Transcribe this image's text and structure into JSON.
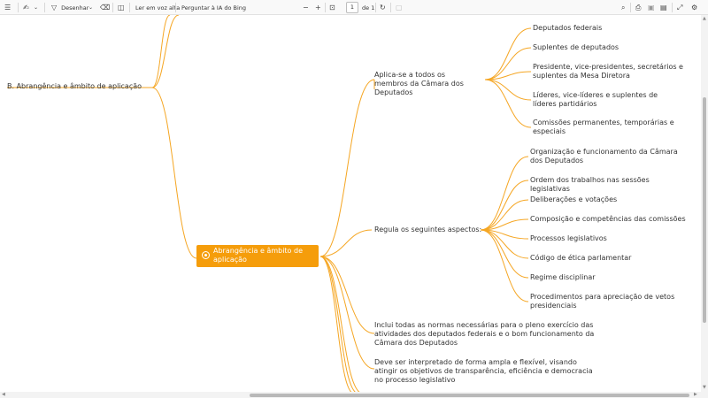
{
  "toolbar": {
    "draw_label": "Desenhar",
    "read_aloud_label": "Ler em voz alta",
    "ask_bing_label": "Perguntar à IA do Bing",
    "page_current": "1",
    "page_total": "de 1",
    "zoom_out_symbol": "−",
    "zoom_in_symbol": "+",
    "icons": [
      "contents-icon",
      "highlight-icon",
      "draw-icon",
      "eraser-icon",
      "page-view-icon",
      "zoom-out-icon",
      "zoom-in-icon",
      "fit-page-icon",
      "rotate-icon",
      "print-icon",
      "save-icon",
      "save-as-icon",
      "fullscreen-icon",
      "settings-icon"
    ]
  },
  "mindmap": {
    "branch_color": "#f5a623",
    "center_color": "#f59d0b",
    "center_label": "Abrangência e âmbito de aplicação",
    "left_label": "B. Abrangência e âmbito de aplicação",
    "group1": {
      "label": "Aplica-se a todos os membros da Câmara dos Deputados",
      "items": [
        "Deputados federais",
        "Suplentes de deputados",
        "Presidente, vice-presidentes, secretários e suplentes da Mesa Diretora",
        "Líderes, vice-líderes e suplentes de líderes partidários",
        "Comissões permanentes, temporárias e especiais"
      ]
    },
    "group2": {
      "label": "Regula os seguintes aspectos:",
      "items": [
        "Organização e funcionamento da Câmara dos Deputados",
        "Ordem dos trabalhos nas sessões legislativas",
        "Deliberações e votações",
        "Composição e competências das comissões",
        "Processos legislativos",
        "Código de ética parlamentar",
        "Regime disciplinar",
        "Procedimentos para apreciação de vetos presidenciais"
      ]
    },
    "group3_label": "Inclui todas as normas necessárias para o pleno exercício das atividades dos deputados federais e o bom funcionamento da Câmara dos Deputados",
    "group4_label": "Deve ser interpretado de forma ampla e flexível, visando atingir os objetivos de transparência, eficiência e democracia no processo legislativo"
  }
}
